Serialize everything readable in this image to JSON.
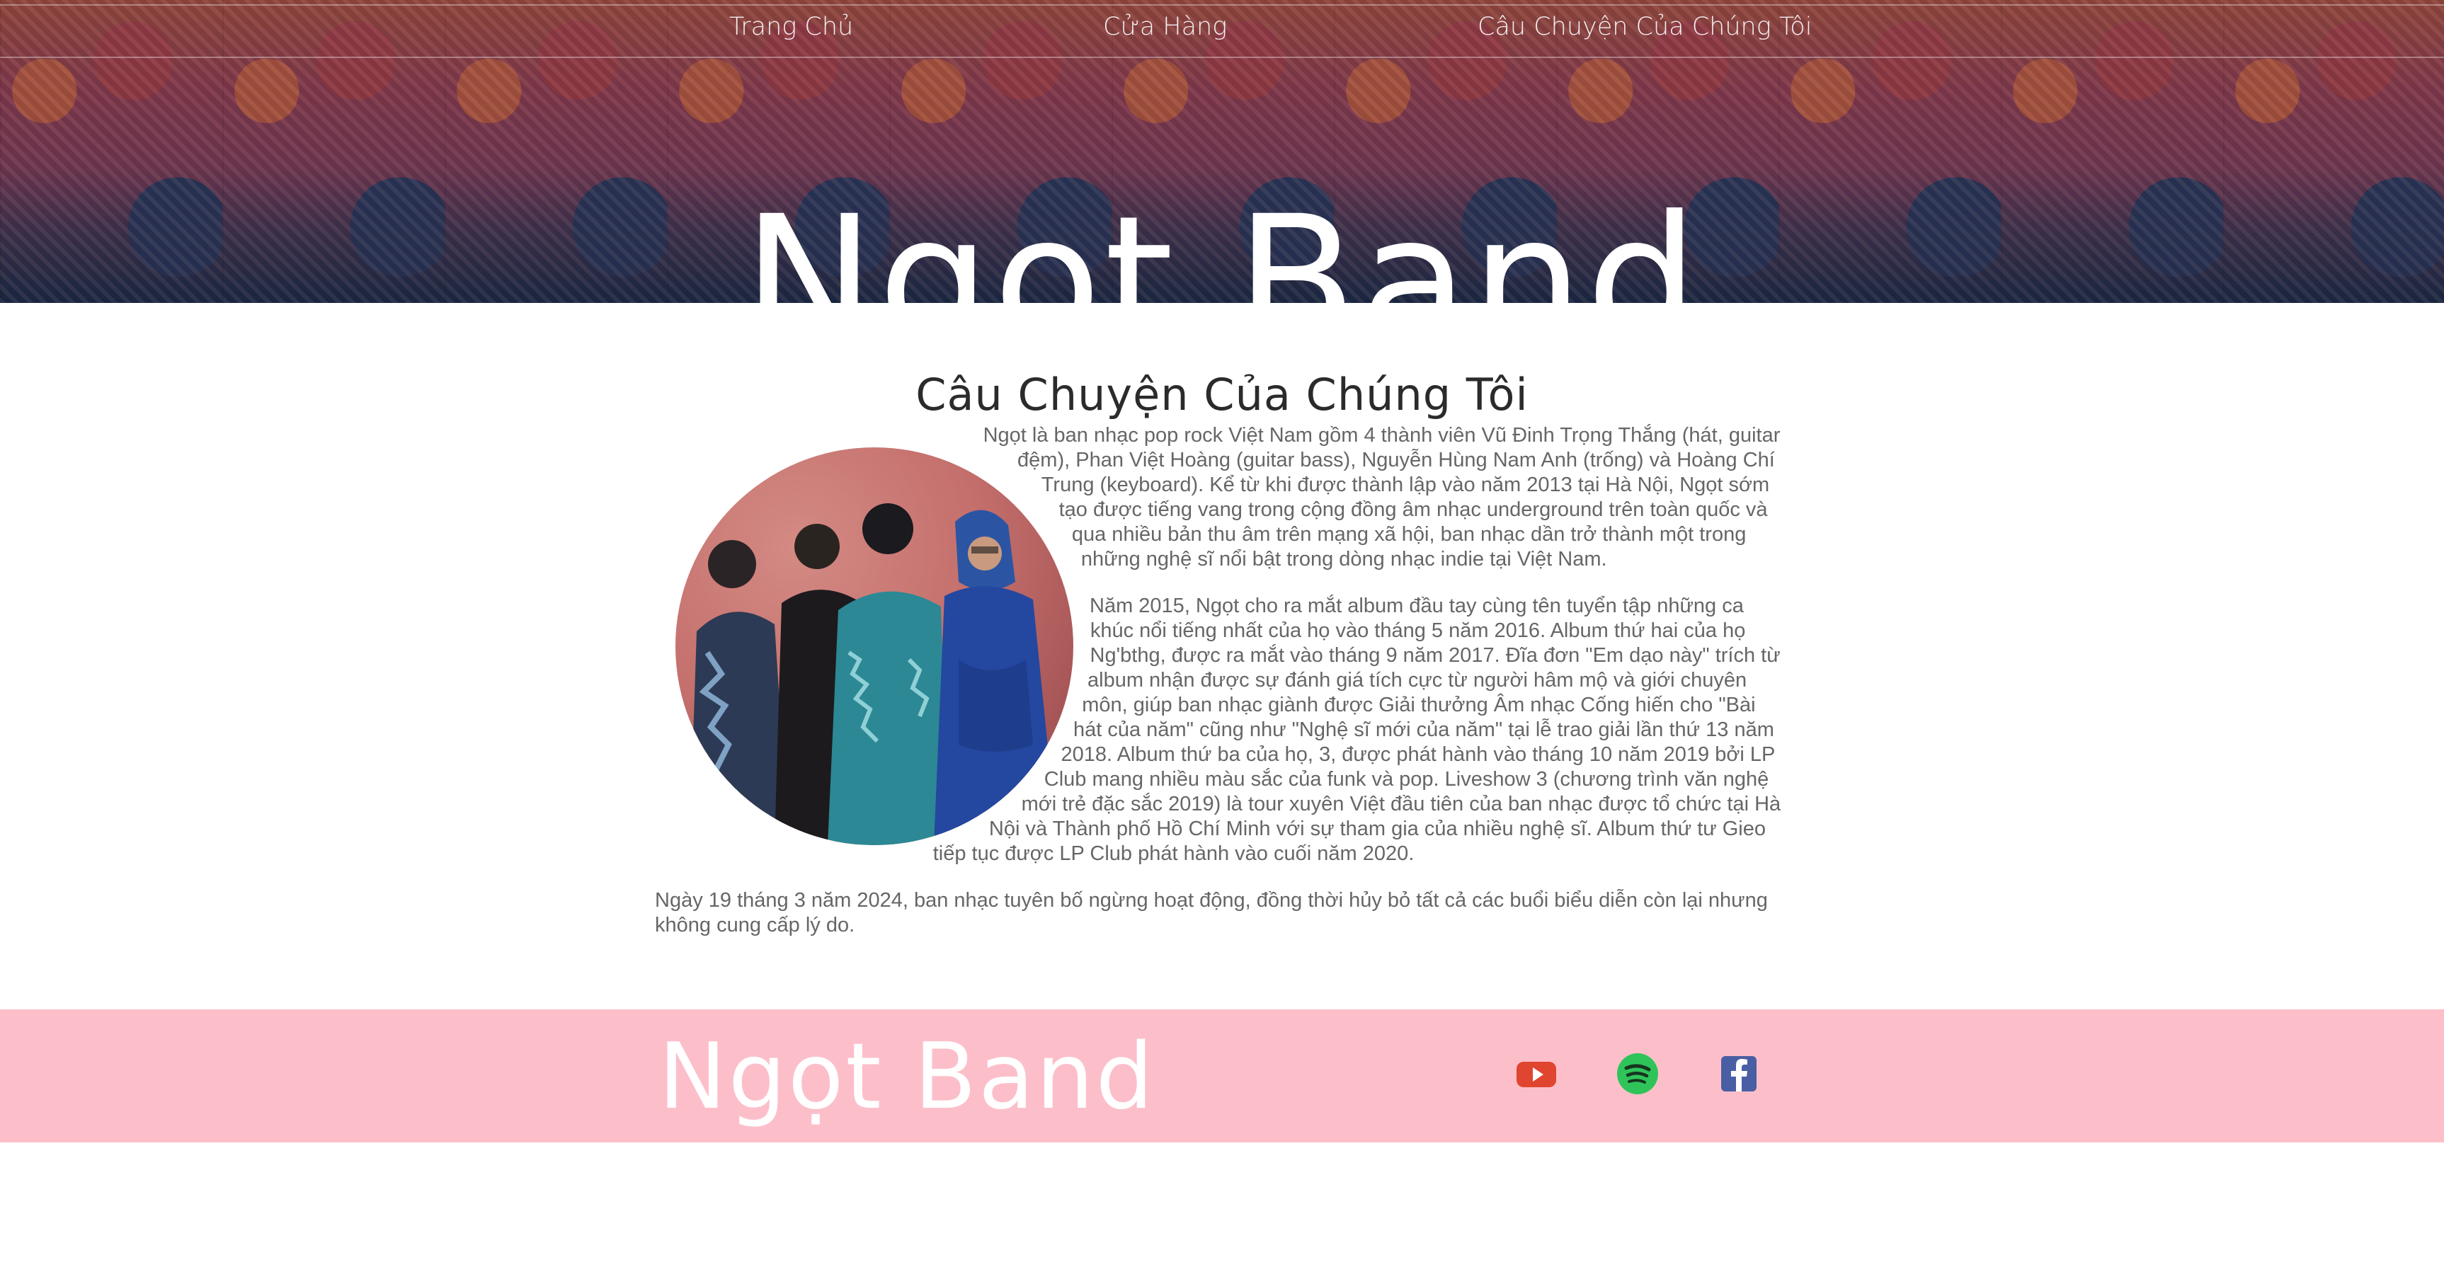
{
  "nav": {
    "items": [
      {
        "label": "Trang Chủ"
      },
      {
        "label": "Cửa Hàng"
      },
      {
        "label": "Câu Chuyện Của Chúng Tôi"
      }
    ]
  },
  "hero": {
    "title": "Ngọt Band"
  },
  "story": {
    "heading": "Câu Chuyện Của Chúng Tôi",
    "paragraphs": [
      "Ngọt là ban nhạc pop rock Việt Nam gồm 4 thành viên Vũ Đinh Trọng Thắng (hát, guitar đệm), Phan Việt Hoàng (guitar bass), Nguyễn Hùng Nam Anh (trống) và Hoàng Chí Trung (keyboard). Kể từ khi được thành lập vào năm 2013 tại Hà Nội, Ngọt sớm tạo được tiếng vang trong cộng đồng âm nhạc underground trên toàn quốc và qua nhiều bản thu âm trên mạng xã hội, ban nhạc dần trở thành một trong những nghệ sĩ nổi bật trong dòng nhạc indie tại Việt Nam.",
      "Năm 2015, Ngọt cho ra mắt album đầu tay cùng tên tuyển tập những ca khúc nổi tiếng nhất của họ vào tháng 5 năm 2016. Album thứ hai của họ Ng'bthg, được ra mắt vào tháng 9 năm 2017. Đĩa đơn \"Em dạo này\" trích từ album nhận được sự đánh giá tích cực từ người hâm mộ và giới chuyên môn, giúp ban nhạc giành được Giải thưởng Âm nhạc Cống hiến cho \"Bài hát của năm\" cũng như \"Nghệ sĩ mới của năm\" tại lễ trao giải lần thứ 13 năm 2018. Album thứ ba của họ, 3, được phát hành vào tháng 10 năm 2019 bởi LP Club mang nhiều màu sắc của funk và pop. Liveshow 3 (chương trình văn nghệ mới trẻ đặc sắc 2019) là tour xuyên Việt đầu tiên của ban nhạc được tổ chức tại Hà Nội và Thành phố Hồ Chí Minh với sự tham gia của nhiều nghệ sĩ. Album thứ tư Gieo tiếp tục được LP Club phát hành vào cuối năm 2020.",
      "Ngày 19 tháng 3 năm 2024, ban nhạc tuyên bố ngừng hoạt động, đồng thời hủy bỏ tất cả các buổi biểu diễn còn lại nhưng không cung cấp lý do."
    ]
  },
  "footer": {
    "brand": "Ngọt Band",
    "social": [
      {
        "icon": "youtube-icon",
        "color": "#e0452f"
      },
      {
        "icon": "spotify-icon",
        "color": "#2fc45a"
      },
      {
        "icon": "facebook-icon",
        "color": "#4a5fa3"
      }
    ]
  },
  "colors": {
    "footer_bg": "#fcbfca",
    "heading_text": "#2b2b2b",
    "body_text": "#666666"
  }
}
